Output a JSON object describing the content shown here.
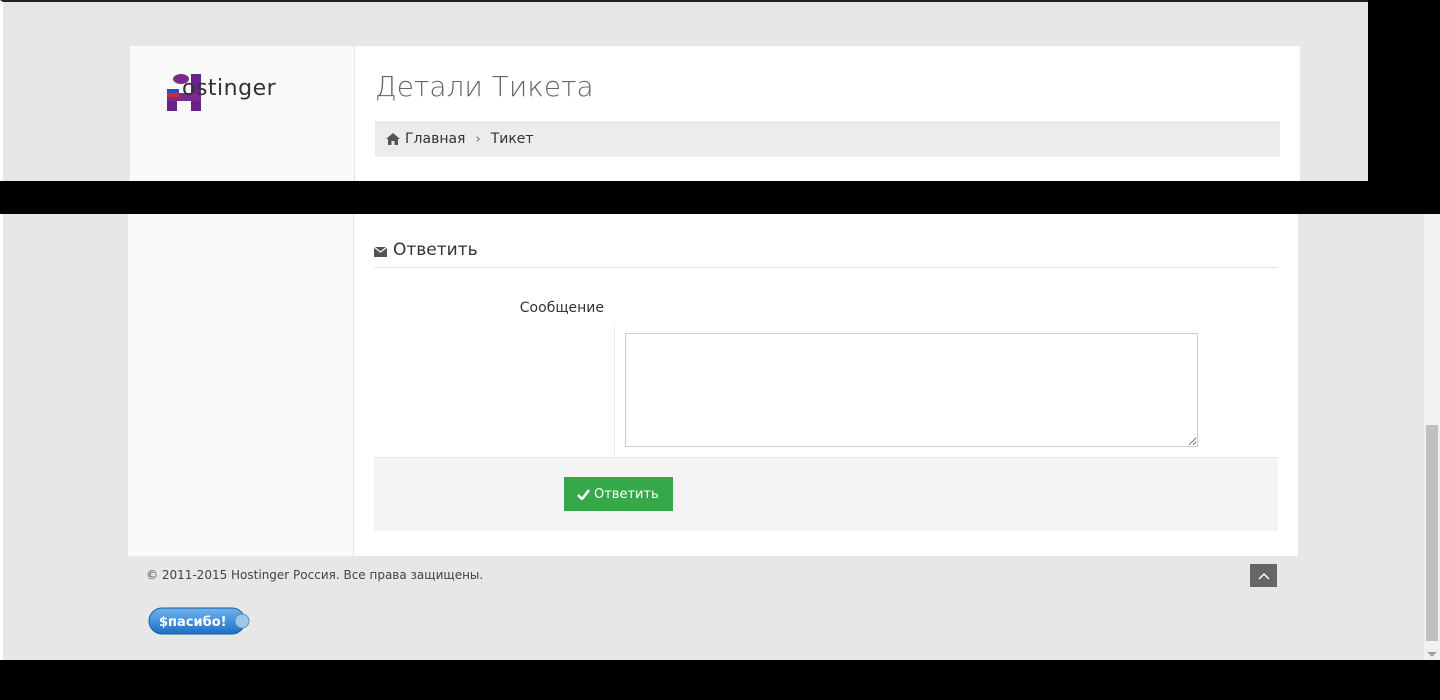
{
  "logo": {
    "text": "ostinger",
    "alt": "Hostinger"
  },
  "header": {
    "title": "Детали Тикета"
  },
  "breadcrumb": {
    "items": [
      "Главная",
      "Тикет"
    ]
  },
  "reply": {
    "section_title": "Ответить",
    "message_label": "Сообщение",
    "message_value": "",
    "submit_label": "Ответить"
  },
  "footer": {
    "copyright": "© 2011-2015 Hostinger Россия. Все права защищены.",
    "badge": "$пасибо!"
  },
  "colors": {
    "accent": "#35a94a",
    "brand": "#7b2a8f",
    "background": "#e7e7e7"
  }
}
